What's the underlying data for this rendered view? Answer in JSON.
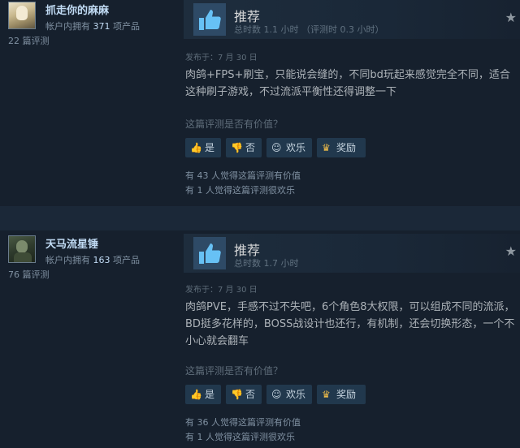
{
  "reviews": [
    {
      "reviewer": {
        "name": "抓走你的麻麻",
        "owned_prefix": "帐户内拥有",
        "owned_count": "371",
        "owned_suffix": "项产品",
        "review_count": "22 篇评测"
      },
      "verdict": "推荐",
      "hours": "总时数 1.1 小时  （评测时 0.3 小时）",
      "posted": "发布于：7 月 30 日",
      "text": "肉鸽+FPS+刷宝，只能说会缝的，不同bd玩起来感觉完全不同，适合这种刷子游戏，不过流派平衡性还得调整一下",
      "helpful_question": "这篇评测是否有价值？",
      "buttons": {
        "yes": "是",
        "no": "否",
        "funny": "欢乐",
        "award": "奖励"
      },
      "helpful_stat": "有 43 人觉得这篇评测有价值",
      "funny_stat": "有 1 人觉得这篇评测很欢乐"
    },
    {
      "reviewer": {
        "name": "天马流星锤",
        "owned_prefix": "帐户内拥有",
        "owned_count": "163",
        "owned_suffix": "项产品",
        "review_count": "76 篇评测"
      },
      "verdict": "推荐",
      "hours": "总时数 1.7 小时",
      "posted": "发布于：7 月 30 日",
      "text": "肉鸽PVE，手感不过不失吧，6个角色8大权限，可以组成不同的流派，BD挺多花样的，BOSS战设计也还行，有机制，还会切换形态，一个不小心就会翻车",
      "helpful_question": "这篇评测是否有价值？",
      "buttons": {
        "yes": "是",
        "no": "否",
        "funny": "欢乐",
        "award": "奖励"
      },
      "helpful_stat": "有 36 人觉得这篇评测有价值",
      "funny_stat": "有 1 人觉得这篇评测很欢乐"
    }
  ]
}
